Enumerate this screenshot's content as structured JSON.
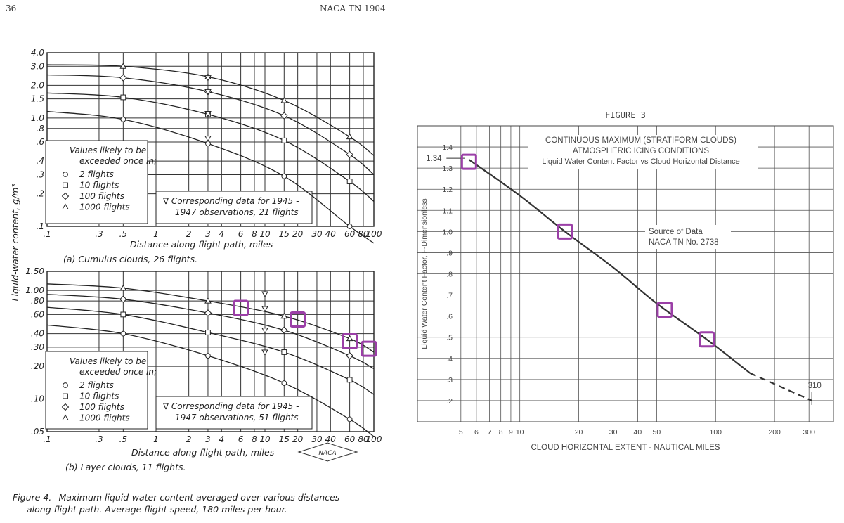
{
  "header": {
    "page_number": "36",
    "report_id": "NACA TN 1904"
  },
  "left_figure": {
    "y_axis_label": "Liquid-water content, g/m³",
    "caption": "Figure 4.– Maximum liquid-water content averaged over various distances along flight path. Average flight speed, 180 miles per hour.",
    "caption_line1": "Figure 4.– Maximum liquid-water content averaged over various distances",
    "caption_line2": "along flight path.  Average flight speed, 180 miles per hour.",
    "logo_text": "NACA"
  },
  "chart_data": [
    {
      "id": "cumulus",
      "type": "line",
      "title": "(a) Cumulus clouds, 26 flights.",
      "xlabel": "Distance along flight path, miles",
      "ylabel": "Liquid-water content, g/m³",
      "x_scale": "log",
      "y_scale": "log",
      "xlim": [
        0.1,
        100
      ],
      "ylim": [
        0.1,
        4.0
      ],
      "x_ticks": [
        "0.1",
        "0.3",
        "0.5",
        "1",
        "2",
        "3",
        "4",
        "6",
        "8",
        "10",
        "15",
        "20",
        "30",
        "40",
        "60",
        "80",
        "100"
      ],
      "x_tick_labels": [
        ".1",
        ".3",
        ".5",
        "1",
        "2",
        "3",
        "4",
        "6",
        "8",
        "10",
        "15",
        "20",
        "30",
        "40",
        "60",
        "80",
        "100"
      ],
      "y_ticks": [
        "0.1",
        "0.2",
        "0.3",
        "0.4",
        "0.6",
        "0.8",
        "1.0",
        "1.5",
        "2.0",
        "3.0",
        "4.0"
      ],
      "y_tick_labels": [
        ".1",
        ".2",
        ".3",
        ".4",
        ".6",
        ".8",
        "1.0",
        "1.5",
        "2.0",
        "3.0",
        "4.0"
      ],
      "legend_title_line1": "Values likely to be",
      "legend_title_line2": "exceeded once in;",
      "legend": [
        "2 flights",
        "10 flights",
        "100 flights",
        "1000 flights"
      ],
      "note_line1": "∇ Corresponding data for 1945 -",
      "note_line2": "1947 observations, 21 flights",
      "series": [
        {
          "name": "2 flights",
          "marker": "circle",
          "x": [
            0.1,
            0.5,
            3,
            15,
            60,
            100
          ],
          "y": [
            1.15,
            0.97,
            0.58,
            0.29,
            0.1,
            0.07
          ]
        },
        {
          "name": "10 flights",
          "marker": "square",
          "x": [
            0.1,
            0.5,
            3,
            15,
            60,
            100
          ],
          "y": [
            1.7,
            1.55,
            1.08,
            0.62,
            0.26,
            0.17
          ]
        },
        {
          "name": "100 flights",
          "marker": "diamond",
          "x": [
            0.1,
            0.5,
            3,
            15,
            60,
            100
          ],
          "y": [
            2.5,
            2.35,
            1.75,
            1.05,
            0.46,
            0.3
          ]
        },
        {
          "name": "1000 flights",
          "marker": "triangle",
          "x": [
            0.1,
            0.5,
            3,
            15,
            60,
            100
          ],
          "y": [
            3.1,
            3.0,
            2.4,
            1.45,
            0.67,
            0.45
          ]
        }
      ],
      "observations": {
        "x": [
          3,
          3,
          3,
          3
        ],
        "y": [
          2.35,
          1.75,
          1.1,
          0.65
        ]
      }
    },
    {
      "id": "layer",
      "type": "line",
      "title": "(b) Layer clouds, 11 flights.",
      "xlabel": "Distance along flight path, miles",
      "ylabel": "Liquid-water content, g/m³",
      "x_scale": "log",
      "y_scale": "log",
      "xlim": [
        0.1,
        100
      ],
      "ylim": [
        0.05,
        1.5
      ],
      "x_ticks": [
        "0.1",
        "0.3",
        "0.5",
        "1",
        "2",
        "3",
        "4",
        "6",
        "8",
        "10",
        "15",
        "20",
        "30",
        "40",
        "60",
        "80",
        "100"
      ],
      "x_tick_labels": [
        ".1",
        ".3",
        ".5",
        "1",
        "2",
        "3",
        "4",
        "6",
        "8",
        "10",
        "15",
        "20",
        "30",
        "40",
        "60",
        "80",
        "100"
      ],
      "y_ticks": [
        "0.05",
        "0.1",
        "0.2",
        "0.3",
        "0.4",
        "0.6",
        "0.8",
        "1.0",
        "1.5"
      ],
      "y_tick_labels": [
        ".05",
        ".10",
        ".20",
        ".30",
        ".40",
        ".60",
        ".80",
        "1.00",
        "1.50"
      ],
      "legend_title_line1": "Values likely to be",
      "legend_title_line2": "exceeded once in;",
      "legend": [
        "2 flights",
        "10 flights",
        "100 flights",
        "1000 flights"
      ],
      "note_line1": "∇ Corresponding data for 1945 -",
      "note_line2": "1947 observations, 51 flights",
      "series": [
        {
          "name": "2 flights",
          "marker": "circle",
          "x": [
            0.1,
            0.5,
            3,
            15,
            60,
            100
          ],
          "y": [
            0.48,
            0.4,
            0.25,
            0.14,
            0.065,
            0.045
          ]
        },
        {
          "name": "10 flights",
          "marker": "square",
          "x": [
            0.1,
            0.5,
            3,
            15,
            60,
            100
          ],
          "y": [
            0.7,
            0.6,
            0.41,
            0.27,
            0.15,
            0.11
          ]
        },
        {
          "name": "100 flights",
          "marker": "diamond",
          "x": [
            0.1,
            0.5,
            3,
            15,
            60,
            100
          ],
          "y": [
            0.92,
            0.83,
            0.62,
            0.43,
            0.25,
            0.19
          ]
        },
        {
          "name": "1000 flights",
          "marker": "triangle",
          "x": [
            0.1,
            0.5,
            3,
            15,
            60,
            100
          ],
          "y": [
            1.15,
            1.05,
            0.8,
            0.58,
            0.36,
            0.27
          ]
        }
      ],
      "observations": {
        "x": [
          10,
          10,
          10,
          10
        ],
        "y": [
          0.93,
          0.68,
          0.43,
          0.27
        ]
      },
      "highlights": [
        {
          "x": 6,
          "y": 0.69
        },
        {
          "x": 20,
          "y": 0.54
        },
        {
          "x": 60,
          "y": 0.34
        },
        {
          "x": 90,
          "y": 0.29
        }
      ]
    },
    {
      "id": "figure3",
      "type": "line",
      "figure_label": "FIGURE 3",
      "title_lines": [
        "CONTINUOUS MAXIMUM (STRATIFORM CLOUDS)",
        "ATMOSPHERIC ICING CONDITIONS",
        "Liquid Water Content Factor vs Cloud Horizontal Distance"
      ],
      "xlabel": "CLOUD HORIZONTAL EXTENT - NAUTICAL MILES",
      "ylabel": "Liquid Water Content Factor, F-Dimensionless",
      "x_scale": "log",
      "xlim": [
        3,
        400
      ],
      "ylim": [
        0.1,
        1.5
      ],
      "x_ticks": [
        "5",
        "6",
        "7",
        "8",
        "9",
        "10",
        "20",
        "30",
        "40",
        "50",
        "100",
        "200",
        "300"
      ],
      "y_ticks": [
        "0.2",
        "0.3",
        "0.4",
        "0.5",
        "0.6",
        "0.7",
        "0.8",
        "0.9",
        "1.0",
        "1.1",
        "1.2",
        "1.3",
        "1.4"
      ],
      "y_tick_labels": [
        ".2",
        ".3",
        ".4",
        ".5",
        ".6",
        ".7",
        ".8",
        ".9",
        "1.0",
        "1.1",
        "1.2",
        "1.3",
        "1.4"
      ],
      "source_line1": "Source of Data",
      "source_line2": "NACA TN No. 2738",
      "start_label": "1.34",
      "end_label": "310",
      "series": [
        {
          "name": "",
          "x": [
            5.5,
            10,
            17,
            30,
            50,
            90,
            150
          ],
          "y": [
            1.34,
            1.17,
            1.0,
            0.83,
            0.66,
            0.49,
            0.33
          ],
          "style": "solid"
        },
        {
          "name": "",
          "x": [
            150,
            310
          ],
          "y": [
            0.33,
            0.2
          ],
          "style": "dashed"
        }
      ],
      "highlights": [
        {
          "x": 5.5,
          "y": 1.33
        },
        {
          "x": 17,
          "y": 1.0
        },
        {
          "x": 55,
          "y": 0.63
        },
        {
          "x": 90,
          "y": 0.49
        }
      ],
      "highlight_color": "#9b3fa7"
    }
  ]
}
